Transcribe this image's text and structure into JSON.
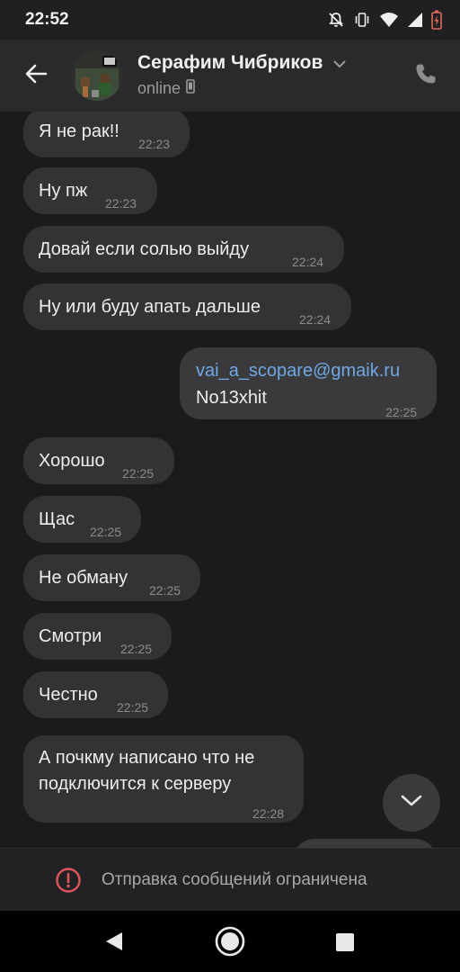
{
  "status_bar": {
    "time": "22:52"
  },
  "header": {
    "contact_name": "Серафим Чибриков",
    "contact_status": "online"
  },
  "messages": [
    {
      "id": "m1",
      "direction": "in",
      "text": "Я не рак!!",
      "time": "22:23"
    },
    {
      "id": "m2",
      "direction": "in",
      "text": "Ну пж",
      "time": "22:23"
    },
    {
      "id": "m3",
      "direction": "in",
      "text": "Довай если солью выйду",
      "time": "22:24"
    },
    {
      "id": "m4",
      "direction": "in",
      "text": "Ну или буду апать дальше",
      "time": "22:24"
    },
    {
      "id": "m5",
      "direction": "out",
      "link": "vai_a_scopare@gmaik.ru",
      "text": "No13xhit",
      "time": "22:25"
    },
    {
      "id": "m6",
      "direction": "in",
      "text": "Хорошо",
      "time": "22:25"
    },
    {
      "id": "m7",
      "direction": "in",
      "text": "Щас",
      "time": "22:25"
    },
    {
      "id": "m8",
      "direction": "in",
      "text": "Не обману",
      "time": "22:25"
    },
    {
      "id": "m9",
      "direction": "in",
      "text": "Смотри",
      "time": "22:25"
    },
    {
      "id": "m10",
      "direction": "in",
      "text": "Честно",
      "time": "22:25"
    },
    {
      "id": "m11",
      "direction": "in",
      "line1": "А почкму написано что не",
      "line2": "подключится к серверу",
      "time": "22:28"
    }
  ],
  "restriction": {
    "text": "Отправка сообщений ограничена"
  },
  "colors": {
    "background": "#1b1b1b",
    "bubble_incoming": "#333335",
    "bubble_outgoing": "#3a3a3c",
    "link": "#6fa8e6",
    "alert": "#e0555e"
  },
  "icons": {
    "back": "arrow-left-icon",
    "call": "phone-icon",
    "device": "phone-device-icon",
    "scroll": "chevron-down-icon",
    "restriction": "exclamation-circle-icon"
  }
}
